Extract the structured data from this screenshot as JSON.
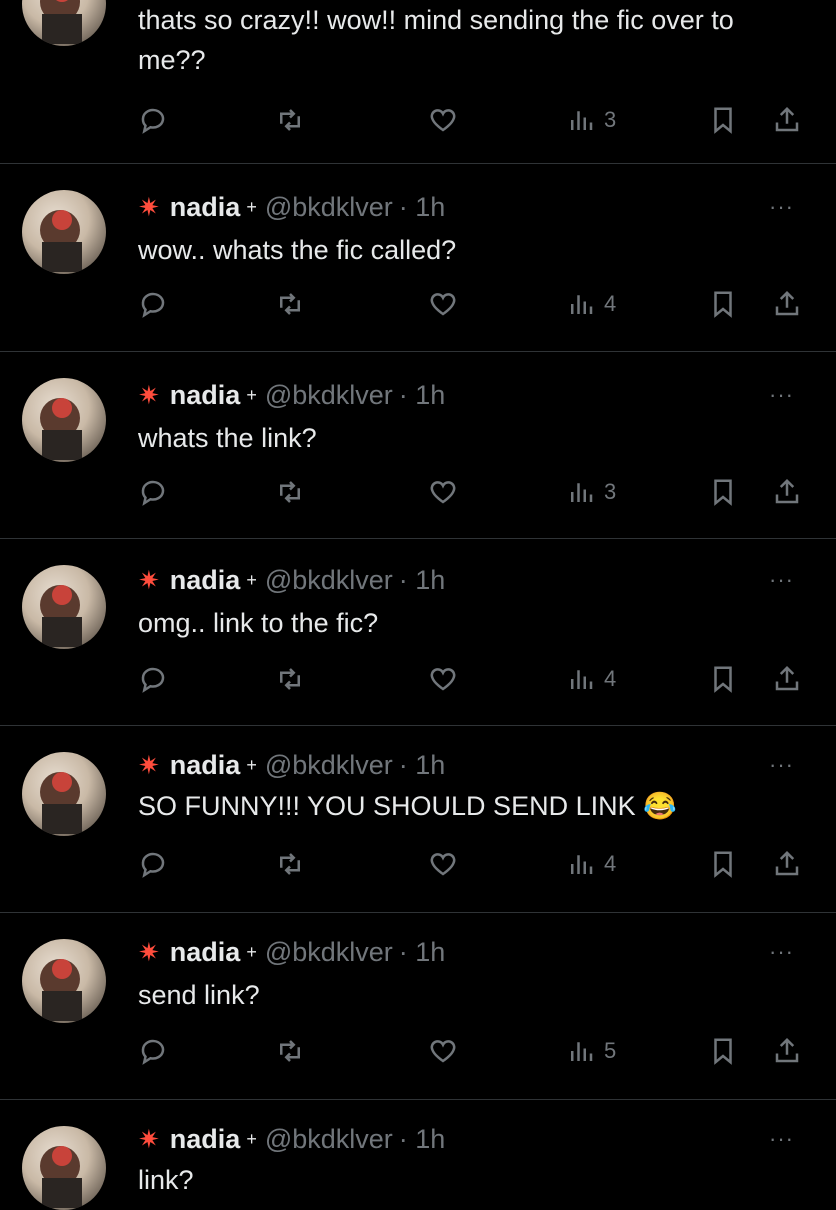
{
  "posts": [
    {
      "text": "thats so crazy!! wow!! mind sending the fic over to me??",
      "views": "3"
    },
    {
      "spark": "✷",
      "name": "nadia",
      "badge": "+",
      "handle": "@bkdklver",
      "time": "· 1h",
      "more": "···",
      "text": "wow.. whats the fic called?",
      "views": "4"
    },
    {
      "spark": "✷",
      "name": "nadia",
      "badge": "+",
      "handle": "@bkdklver",
      "time": "· 1h",
      "more": "···",
      "text": "whats the link?",
      "views": "3"
    },
    {
      "spark": "✷",
      "name": "nadia",
      "badge": "+",
      "handle": "@bkdklver",
      "time": "· 1h",
      "more": "···",
      "text": "omg.. link to the fic?",
      "views": "4"
    },
    {
      "spark": "✷",
      "name": "nadia",
      "badge": "+",
      "handle": "@bkdklver",
      "time": "· 1h",
      "more": "···",
      "text": "SO FUNNY!!! YOU SHOULD SEND LINK 😂",
      "views": "4"
    },
    {
      "spark": "✷",
      "name": "nadia",
      "badge": "+",
      "handle": "@bkdklver",
      "time": "· 1h",
      "more": "···",
      "text": "send link?",
      "views": "5"
    },
    {
      "spark": "✷",
      "name": "nadia",
      "badge": "+",
      "handle": "@bkdklver",
      "time": "· 1h",
      "more": "···",
      "text": "link?"
    }
  ],
  "icons": {
    "reply": "reply-icon",
    "repost": "repost-icon",
    "like": "like-icon",
    "views": "views-icon",
    "bookmark": "bookmark-icon",
    "share": "share-icon"
  },
  "colors": {
    "background": "#000000",
    "text": "#e7e9ea",
    "muted": "#71767b",
    "divider": "#2f3336",
    "spark": "#ff4d3d"
  }
}
